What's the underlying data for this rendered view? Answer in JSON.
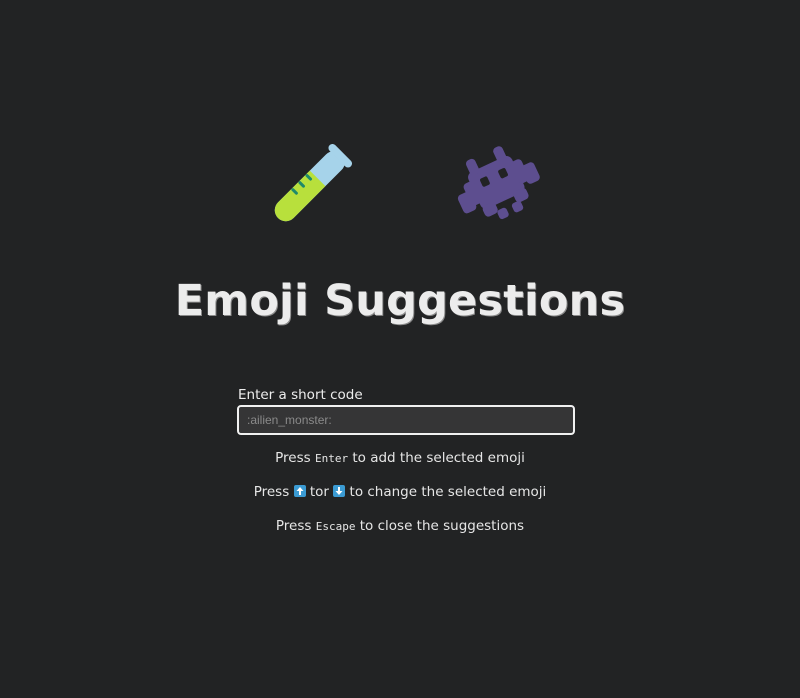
{
  "title": "Emoji Suggestions",
  "hero_icons": [
    "test-tube-icon",
    "alien-monster-icon"
  ],
  "input": {
    "label": "Enter a short code",
    "placeholder": ":ailien_monster:",
    "value": ""
  },
  "hints": {
    "enter": {
      "prefix": "Press",
      "key": "Enter",
      "suffix": "to add the selected emoji"
    },
    "arrows": {
      "prefix": "Press",
      "up_icon": "arrow-up-icon",
      "middle": "tor",
      "down_icon": "arrow-down-icon",
      "suffix": "to change the selected emoji"
    },
    "escape": {
      "prefix": "Press",
      "key": "Escape",
      "suffix": "to close the suggestions"
    }
  },
  "colors": {
    "background": "#222324",
    "tube_liquid": "#b8e03c",
    "tube_glass": "#a6d3ea",
    "tube_marks": "#1f8a6a",
    "alien": "#5d4e8f",
    "arrow_key": "#3b9bd3"
  }
}
